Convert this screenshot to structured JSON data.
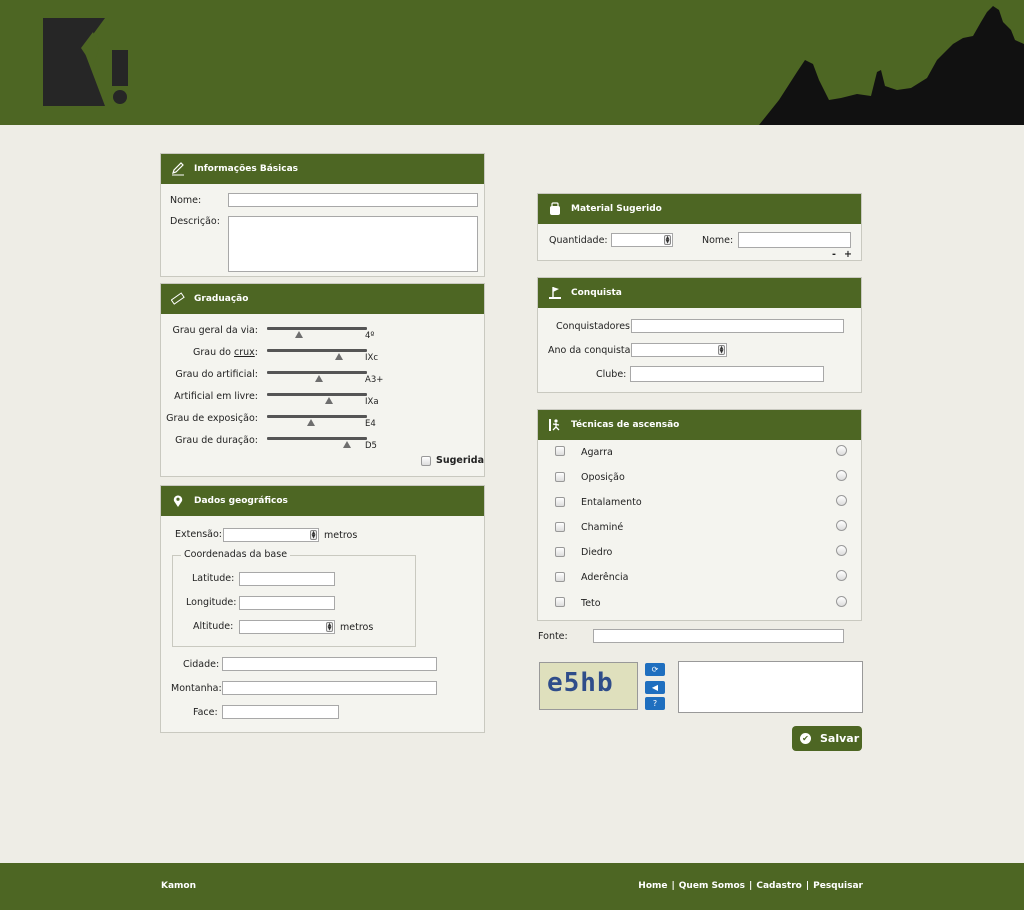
{
  "header": {
    "logo_text": "K!"
  },
  "basic": {
    "title": "Informações Básicas",
    "name_label": "Nome:",
    "desc_label": "Descrição:"
  },
  "grading": {
    "title": "Graduação",
    "rows": [
      {
        "label": "Grau geral da via:",
        "value": "4º",
        "level": 0.32
      },
      {
        "label_pre": "Grau do ",
        "label_link": "crux",
        "label_post": ":",
        "value": "IXc",
        "level": 0.72
      },
      {
        "label": "Grau do artificial:",
        "value": "A3+",
        "level": 0.52
      },
      {
        "label": "Artificial em livre:",
        "value": "IXa",
        "level": 0.62
      },
      {
        "label": "Grau de exposição:",
        "value": "E4",
        "level": 0.44
      },
      {
        "label": "Grau de duração:",
        "value": "D5",
        "level": 0.8
      }
    ],
    "suggested_label": "Sugerida"
  },
  "geo": {
    "title": "Dados geográficos",
    "extension_label": "Extensão:",
    "extension_unit": "metros",
    "coords_legend": "Coordenadas da base",
    "latitude_label": "Latitude:",
    "longitude_label": "Longitude:",
    "altitude_label": "Altitude:",
    "altitude_unit": "metros",
    "city_label": "Cidade:",
    "mountain_label": "Montanha:",
    "face_label": "Face:"
  },
  "material": {
    "title": "Material Sugerido",
    "quantity_label": "Quantidade:",
    "name_label": "Nome:",
    "minus": "-",
    "plus": "+"
  },
  "conquest": {
    "title": "Conquista",
    "conquerors_label": "Conquistadores:",
    "year_label": "Ano da conquista:",
    "club_label": "Clube:"
  },
  "techniques": {
    "title": "Técnicas de ascensão",
    "items": [
      "Agarra",
      "Oposição",
      "Entalamento",
      "Chaminé",
      "Diedro",
      "Aderência",
      "Teto"
    ]
  },
  "source_label": "Fonte:",
  "captcha": {
    "text": "e5hb"
  },
  "save_label": "Salvar",
  "footer": {
    "brand": "Kamon",
    "links": [
      "Home",
      "Quem Somos",
      "Cadastro",
      "Pesquisar"
    ],
    "separator": "|"
  }
}
